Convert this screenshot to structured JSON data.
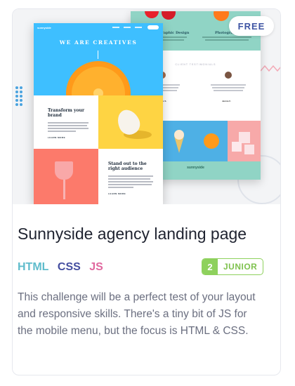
{
  "badge": {
    "label": "FREE"
  },
  "preview": {
    "front": {
      "logo": "sunnyside",
      "hero_title": "WE ARE CREATIVES",
      "section1_title": "Transform your brand",
      "section1_link": "LEARN MORE",
      "section2_title": "Stand out to the right audience",
      "section2_link": "LEARN MORE"
    },
    "back": {
      "label_left": "Graphic Design",
      "label_right": "Photography",
      "testimonials_title": "CLIENT TESTIMONIALS",
      "person1": "Thomas S.",
      "person2": "Jennie F.",
      "footer_logo": "sunnyside"
    }
  },
  "card": {
    "title": "Sunnyside agency landing page",
    "languages": [
      "HTML",
      "CSS",
      "JS"
    ],
    "level_number": "2",
    "level_name": "JUNIOR",
    "description": "This challenge will be a perfect test of your layout and responsive skills. There's a tiny bit of JS for the mobile menu, but the focus is HTML & CSS."
  },
  "colors": {
    "html": "#5fbccc",
    "css": "#444ea0",
    "js": "#e0679e",
    "level": "#8ed15d",
    "hero": "#3ebfff"
  }
}
